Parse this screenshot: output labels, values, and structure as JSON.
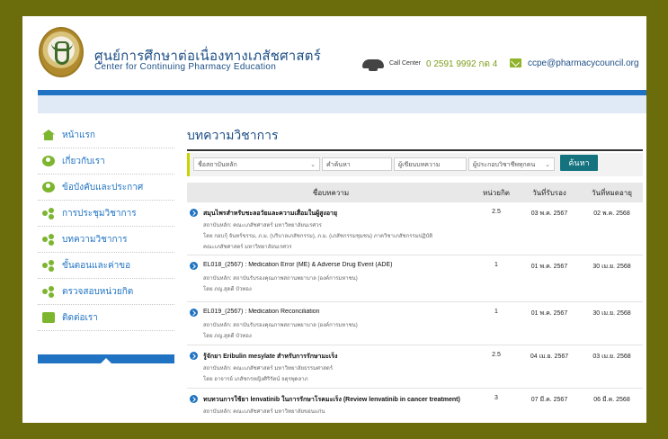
{
  "header": {
    "brand_th": "ศูนย์การศึกษาต่อเนื่องทางเภสัชศาสตร์",
    "brand_en": "Center for Continuing Pharmacy Education",
    "call_label": "Call Center",
    "call_number": "0 2591 9992 กด 4",
    "email": "ccpe@pharmacycouncil.org"
  },
  "sidebar": {
    "items": [
      {
        "label": "หน้าแรก",
        "icon": "home-icon"
      },
      {
        "label": "เกี่ยวกับเรา",
        "icon": "people-icon"
      },
      {
        "label": "ข้อบังคับและประกาศ",
        "icon": "people-icon"
      },
      {
        "label": "การประชุมวิชาการ",
        "icon": "network-icon"
      },
      {
        "label": "บทความวิชาการ",
        "icon": "network-icon"
      },
      {
        "label": "ขั้นตอนและค่าขอ",
        "icon": "network-icon"
      },
      {
        "label": "ตรวจสอบหน่วยกิต",
        "icon": "network-icon"
      },
      {
        "label": "ติดต่อเรา",
        "icon": "chat-icon"
      }
    ]
  },
  "main": {
    "title": "บทความวิชาการ",
    "filters": {
      "institution": "ชื่อสถาบันหลัก",
      "keyword_placeholder": "คำค้นหา",
      "author_placeholder": "ผู้เขียนบทความ",
      "profession": "ผู้ประกอบวิชาชีพทุกคน",
      "search_label": "ค้นหา"
    },
    "table": {
      "headers": [
        "ชื่อบทความ",
        "หน่วยกิต",
        "วันที่รับรอง",
        "วันที่หมดอายุ"
      ],
      "rows": [
        {
          "title": "สมุนไพรสำหรับชะลอวัยและความเสื่อมในผู้สูงอายุ",
          "institution": "สถาบันหลัก: คณะเภสัชศาสตร์ มหาวิทยาลัยนเรศวร",
          "author": "โดย กอบกุ้ จันทร์ขรรม, ภ.ม. (บริบาลเภสัชกรรม), ภ.ม. (เภสัชกรรมชุมชน) ภาควิชาเภสัชกรรมปฏิบัติ",
          "extra": "คณะเภสัชศาสตร์ มหาวิทยาลัยนเรศวร",
          "credit": "2.5",
          "start": "03 พ.ค. 2567",
          "end": "02 พ.ค. 2568"
        },
        {
          "title": "EL018_(2567) : Medication Error (ME) & Adverse Drug Event (ADE)",
          "institution": "สถาบันหลัก: สถาบันรับรองคุณภาพสถานพยาบาล (องค์การมหาชน)",
          "author": "โดย ภญ.สุดดี บัวทอง",
          "extra": "",
          "credit": "1",
          "start": "01 พ.ค. 2567",
          "end": "30 เม.ย. 2568"
        },
        {
          "title": "EL019_(2567) : Medication Reconciliation",
          "institution": "สถาบันหลัก: สถาบันรับรองคุณภาพสถานพยาบาล (องค์การมหาชน)",
          "author": "โดย ภญ.สุดดี บัวทอง",
          "extra": "",
          "credit": "1",
          "start": "01 พ.ค. 2567",
          "end": "30 เม.ย. 2568"
        },
        {
          "title": "รู้จักยา Eribulin mesylate สำหรับการรักษามะเร็ง",
          "institution": "สถาบันหลัก: คณะเภสัชศาสตร์ มหาวิทยาลัยธรรมศาสตร์",
          "author": "โดย อาจารย์ เภสัชกรหญิงศิริรัตน์ จตุรพุดลาภ",
          "extra": "",
          "credit": "2.5",
          "start": "04 เม.ย. 2567",
          "end": "03 เม.ย. 2568"
        },
        {
          "title": "ทบทวนการใช้ยา lenvatinib ในการรักษาโรคมะเร็ง (Review lenvatinib in cancer treatment)",
          "institution": "สถาบันหลัก: คณะเภสัชศาสตร์ มหาวิทยาลัยขอนแก่น",
          "author": "",
          "extra": "",
          "credit": "3",
          "start": "07 มี.ค. 2567",
          "end": "06 มี.ค. 2568"
        }
      ]
    }
  },
  "colors": {
    "frame": "#6b6d0d",
    "accent_blue": "#1f73c2",
    "accent_green": "#7cb52e",
    "button": "#14737f"
  }
}
